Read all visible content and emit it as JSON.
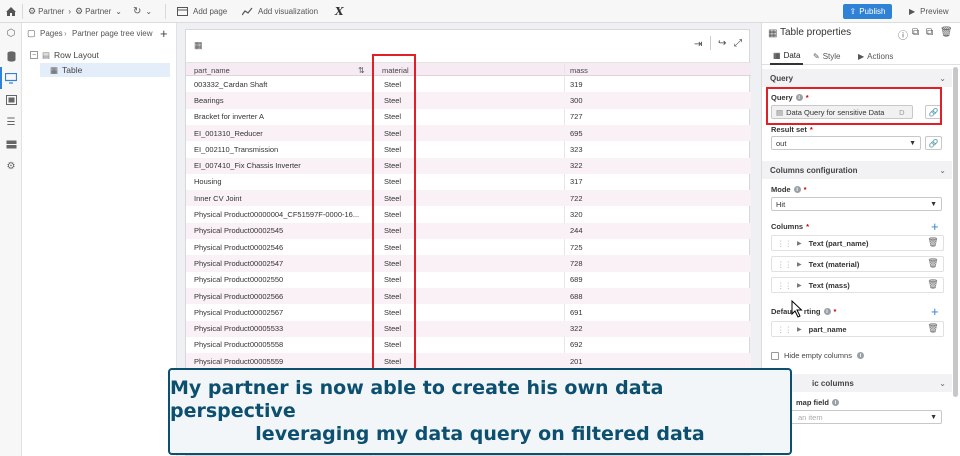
{
  "topbar": {
    "breadcrumb_app": "Partner",
    "breadcrumb_page": "Partner",
    "add_page": "Add page",
    "add_visualization": "Add visualization",
    "x_logo": "X",
    "publish": "Publish",
    "preview": "Preview"
  },
  "tree": {
    "pages_tab": "Pages",
    "tree_tab": "Partner page tree view",
    "row_layout": "Row Layout",
    "table": "Table"
  },
  "grid": {
    "headers": [
      "part_name",
      "material",
      "mass"
    ],
    "rows": [
      [
        "003332_Cardan Shaft",
        "Steel",
        "319"
      ],
      [
        "Bearings",
        "Steel",
        "300"
      ],
      [
        "Bracket for inverter A",
        "Steel",
        "727"
      ],
      [
        "EI_001310_Reducer",
        "Steel",
        "695"
      ],
      [
        "EI_002110_Transmission",
        "Steel",
        "323"
      ],
      [
        "EI_007410_Fix Chassis Inverter",
        "Steel",
        "322"
      ],
      [
        "Housing",
        "Steel",
        "317"
      ],
      [
        "Inner CV Joint",
        "Steel",
        "722"
      ],
      [
        "Physical Product00000004_CF51597F-0000-16...",
        "Steel",
        "320"
      ],
      [
        "Physical Product00002545",
        "Steel",
        "244"
      ],
      [
        "Physical Product00002546",
        "Steel",
        "725"
      ],
      [
        "Physical Product00002547",
        "Steel",
        "728"
      ],
      [
        "Physical Product00002550",
        "Steel",
        "689"
      ],
      [
        "Physical Product00002566",
        "Steel",
        "688"
      ],
      [
        "Physical Product00002567",
        "Steel",
        "691"
      ],
      [
        "Physical Product00005533",
        "Steel",
        "322"
      ],
      [
        "Physical Product00005558",
        "Steel",
        "692"
      ],
      [
        "Physical Product00005559",
        "Steel",
        "201"
      ]
    ]
  },
  "props": {
    "title": "Table properties",
    "tab_data": "Data",
    "tab_style": "Style",
    "tab_actions": "Actions",
    "query_section": "Query",
    "query_label": "Query",
    "query_value": "Data Query for sensitive Data",
    "query_suffix": "D",
    "result_set_label": "Result set",
    "result_set_value": "out",
    "columns_config": "Columns configuration",
    "mode_label": "Mode",
    "mode_value": "Hit",
    "columns_label": "Columns",
    "columns": [
      "Text (part_name)",
      "Text (material)",
      "Text (mass)"
    ],
    "default_sort_label_a": "Defau",
    "default_sort_label_b": "rting",
    "sort_item": "part_name",
    "hide_empty": "Hide empty columns",
    "dynamic_columns_tail": "ic columns",
    "map_field_tail": "map field",
    "placeholder_tail": "an item",
    "required_mark": "*"
  },
  "caption": {
    "line1": "My partner is now able to create his own data perspective",
    "line2": "leveraging my data query on filtered data"
  },
  "colors": {
    "accent": "#2f82d6",
    "highlight": "#e02027",
    "caption_text": "#0c4f6e",
    "row_alt": "#f9f1f6"
  }
}
